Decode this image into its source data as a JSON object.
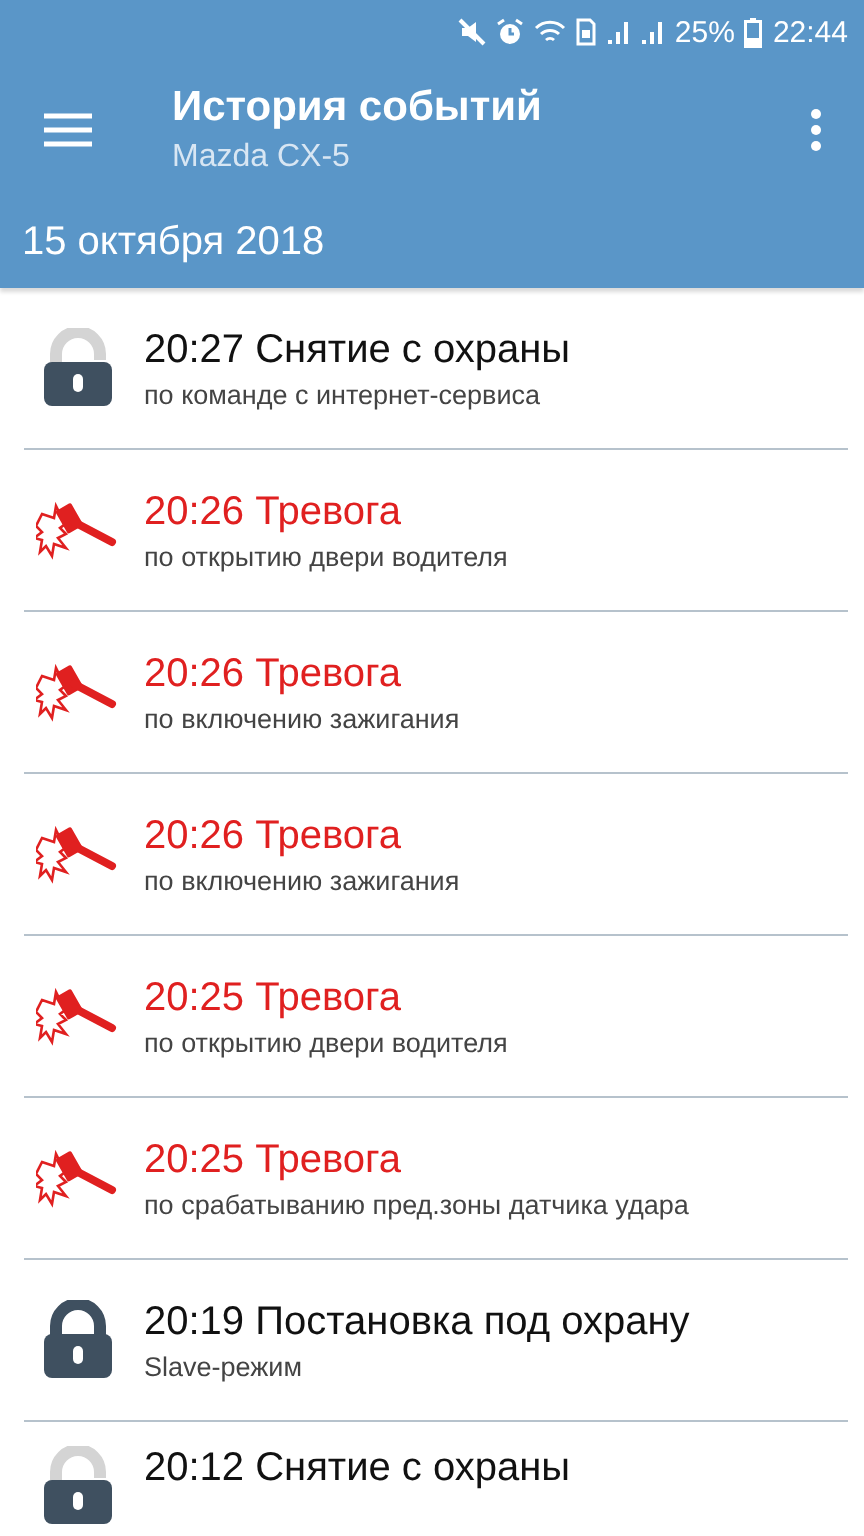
{
  "status_bar": {
    "battery": "25%",
    "time": "22:44"
  },
  "app_bar": {
    "title": "История событий",
    "subtitle": "Mazda CX-5"
  },
  "date_header": "15 октября 2018",
  "events": [
    {
      "kind": "disarm",
      "title": "20:27 Снятие с охраны",
      "detail": "по команде с интернет-сервиса"
    },
    {
      "kind": "alarm",
      "title": "20:26 Тревога",
      "detail": "по открытию двери водителя"
    },
    {
      "kind": "alarm",
      "title": "20:26 Тревога",
      "detail": "по включению зажигания"
    },
    {
      "kind": "alarm",
      "title": "20:26 Тревога",
      "detail": "по включению зажигания"
    },
    {
      "kind": "alarm",
      "title": "20:25 Тревога",
      "detail": "по открытию двери водителя"
    },
    {
      "kind": "alarm",
      "title": "20:25 Тревога",
      "detail": "по срабатыванию пред.зоны датчика удара"
    },
    {
      "kind": "arm",
      "title": "20:19 Постановка под охрану",
      "detail": "Slave-режим"
    },
    {
      "kind": "disarm",
      "title": "20:12 Снятие с охраны"
    }
  ]
}
